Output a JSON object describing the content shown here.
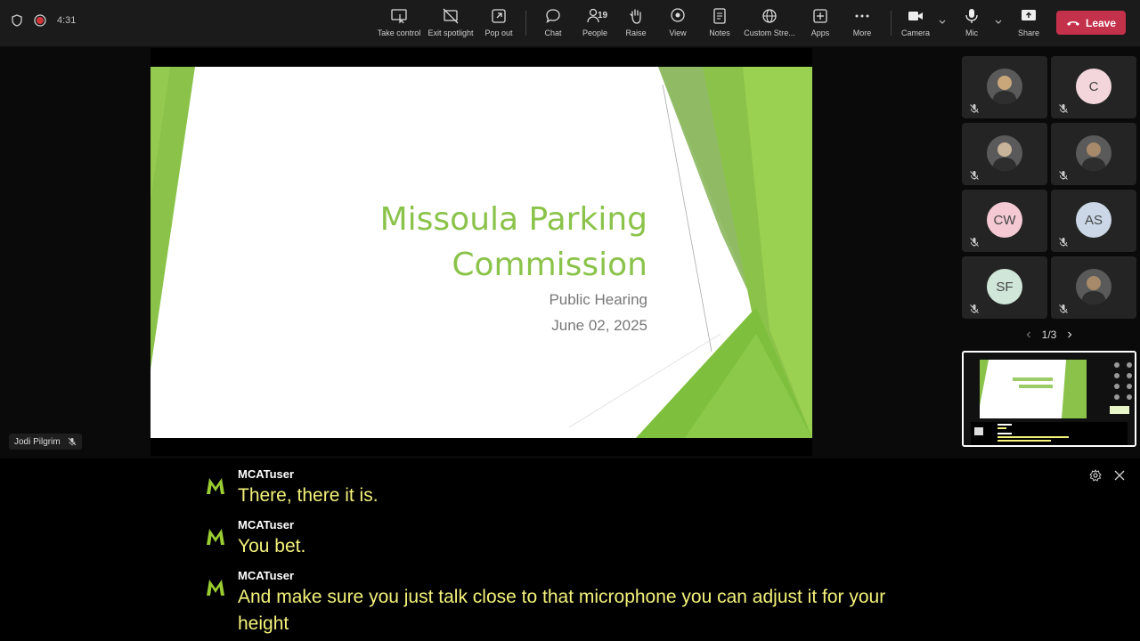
{
  "header": {
    "timer": "4:31"
  },
  "toolbar": {
    "take_control": "Take control",
    "exit_spotlight": "Exit spotlight",
    "pop_out": "Pop out",
    "chat": "Chat",
    "people": "People",
    "people_count": "19",
    "raise": "Raise",
    "view": "View",
    "notes": "Notes",
    "custom_streaming": "Custom Stre...",
    "apps": "Apps",
    "more": "More",
    "camera": "Camera",
    "mic": "Mic",
    "share": "Share",
    "leave": "Leave"
  },
  "slide": {
    "title_line1": "Missoula Parking",
    "title_line2": "Commission",
    "subtitle": "Public Hearing",
    "date": "June 02, 2025",
    "accent_color": "#8bc34a"
  },
  "presenter": {
    "name": "Jodi Pilgrim"
  },
  "participants": [
    {
      "type": "photo",
      "initials": ""
    },
    {
      "type": "initials",
      "initials": "C",
      "color": "#f3d6dc"
    },
    {
      "type": "photo",
      "initials": ""
    },
    {
      "type": "photo",
      "initials": ""
    },
    {
      "type": "initials",
      "initials": "CW",
      "color": "#f4c9d4"
    },
    {
      "type": "initials",
      "initials": "AS",
      "color": "#cbd7e6"
    },
    {
      "type": "initials",
      "initials": "SF",
      "color": "#cfe6d9"
    },
    {
      "type": "photo",
      "initials": ""
    }
  ],
  "pager": {
    "label": "1/3"
  },
  "captions": [
    {
      "speaker": "MCATuser",
      "text": "There, there it is."
    },
    {
      "speaker": "MCATuser",
      "text": "You bet."
    },
    {
      "speaker": "MCATuser",
      "text": "And make sure you just talk close to that microphone you can adjust it for your height"
    }
  ]
}
